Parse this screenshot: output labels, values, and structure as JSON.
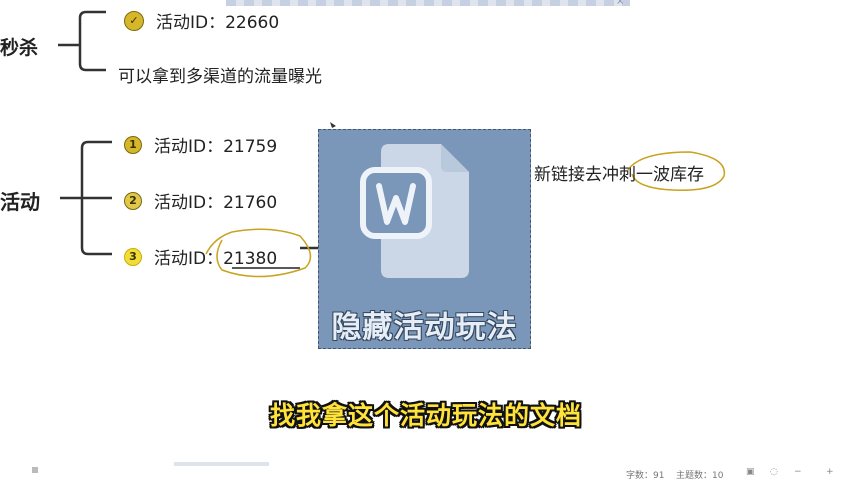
{
  "mindmap": {
    "parent_top": "秒杀",
    "parent_mid": "活动",
    "top_leaf_1": "活动ID：22660",
    "top_leaf_2": "可以拿到多渠道的流量曝光",
    "leaves": [
      {
        "num": "1",
        "text": "活动ID：21759"
      },
      {
        "num": "2",
        "text": "活动ID：21760"
      },
      {
        "num": "3",
        "text": "活动ID：21380"
      }
    ],
    "right_text": "新链接去冲刺一波库存"
  },
  "overlay": {
    "icon": "wps-writer-document-icon",
    "label": "隐藏活动玩法",
    "bg_color": "#7a96b8"
  },
  "subtitle": "找我拿这个活动玩法的文档",
  "status": {
    "word_count": "字数：91",
    "topic_count": "主题数：10"
  },
  "colors": {
    "annotation": "#c9a21e",
    "subtitle": "#ffe23a"
  }
}
